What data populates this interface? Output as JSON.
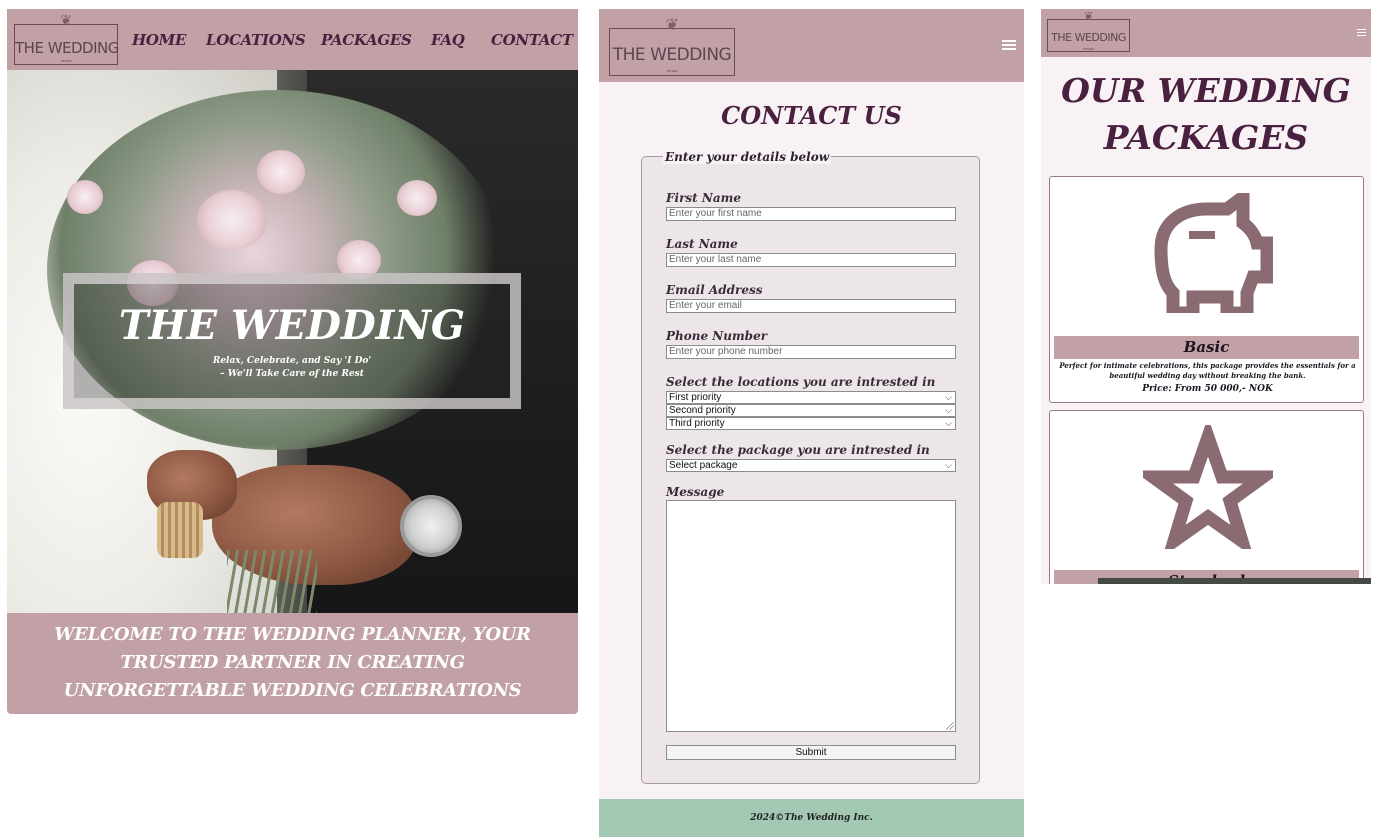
{
  "colors": {
    "mauve": "#c1a0a6",
    "plum": "#4a2040",
    "page_bg": "#f8f2f4",
    "footer_green": "#a3c9b4"
  },
  "logo": {
    "text": "THE WEDDING",
    "est": "EST. 2024"
  },
  "home": {
    "nav": [
      "HOME",
      "LOCATIONS",
      "PACKAGES",
      "FAQ",
      "CONTACT"
    ],
    "hero_title": "THE WEDDING",
    "hero_sub_1": "Relax, Celebrate, and Say 'I Do'",
    "hero_sub_2": "– We'll Take Care of the Rest",
    "welcome_lines": [
      "WELCOME TO THE WEDDING PLANNER, YOUR",
      "TRUSTED PARTNER IN CREATING",
      "UNFORGETTABLE WEDDING CELEBRATIONS"
    ]
  },
  "contact": {
    "title": "CONTACT US",
    "legend": "Enter your details below",
    "first_label": "First Name",
    "first_ph": "Enter your first name",
    "last_label": "Last Name",
    "last_ph": "Enter your last name",
    "email_label": "Email Address",
    "email_ph": "Enter your email",
    "phone_label": "Phone Number",
    "phone_ph": "Enter your phone number",
    "locations_label": "Select the locations you are intrested in",
    "loc1": "First priority",
    "loc2": "Second priority",
    "loc3": "Third priority",
    "package_label": "Select the package you are intrested in",
    "package_value": "Select package",
    "message_label": "Message",
    "submit": "Submit",
    "footer": "2024©The Wedding Inc."
  },
  "packages": {
    "title_1": "OUR WEDDING",
    "title_2": "PACKAGES",
    "basic": {
      "icon": "piggy-bank-icon",
      "name": "Basic",
      "desc": "Perfect for intimate celebrations, this package provides the essentials for a beautiful wedding day without breaking the bank.",
      "price": "Price: From 50 000,- NOK"
    },
    "standard": {
      "icon": "star-icon",
      "name": "Standard"
    }
  }
}
